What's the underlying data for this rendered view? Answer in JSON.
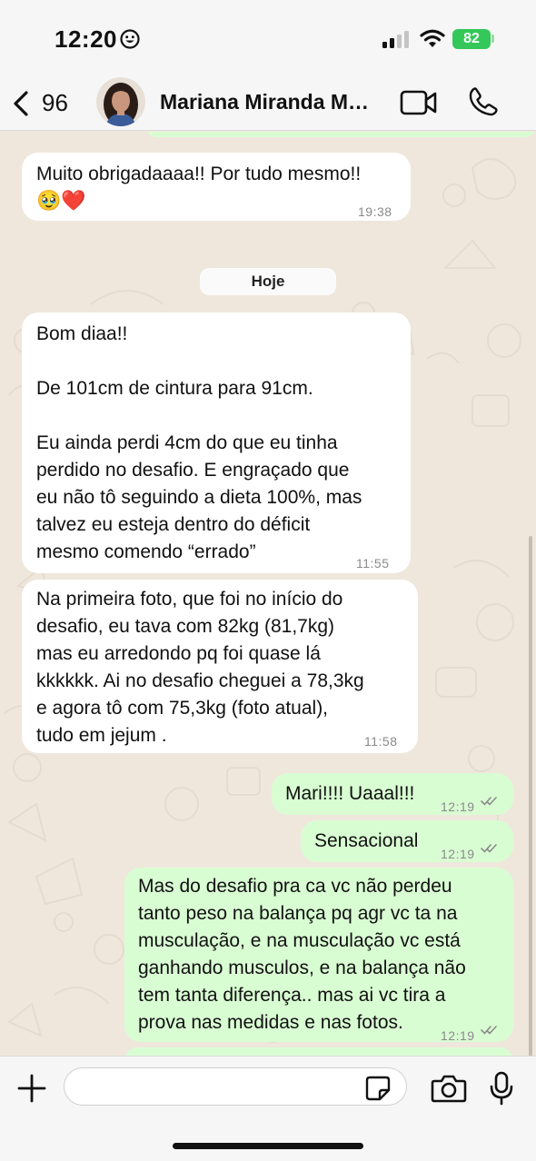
{
  "status_bar": {
    "time": "12:20",
    "battery": "82"
  },
  "header": {
    "back_count": "96",
    "contact_name": "Mariana Miranda Moura"
  },
  "chat": {
    "date_separator": "Hoje",
    "messages": [
      {
        "direction": "in",
        "text": "Muito obrigadaaaa!! Por tudo mesmo!!",
        "emoji": "🥹❤️",
        "time": "19:38"
      },
      {
        "direction": "in",
        "text": "Bom diaa!!\n\nDe 101cm de cintura para 91cm.\n\nEu ainda perdi 4cm do que eu tinha\nperdido no desafio. E engraçado que\neu não tô seguindo a dieta 100%, mas\ntalvez eu esteja dentro do déficit\nmesmo comendo “errado”",
        "time": "11:55"
      },
      {
        "direction": "in",
        "text": "Na primeira foto, que foi no início do\ndesafio, eu tava com 82kg (81,7kg)\nmas eu arredondo pq foi quase lá\nkkkkkk. Ai no desafio cheguei a 78,3kg\ne agora tô com 75,3kg (foto atual),\ntudo em jejum .",
        "time": "11:58"
      },
      {
        "direction": "out",
        "text": "Mari!!!! Uaaal!!!",
        "time": "12:19"
      },
      {
        "direction": "out",
        "text": "Sensacional",
        "time": "12:19"
      },
      {
        "direction": "out",
        "text": "Mas do desafio pra ca vc não perdeu\ntanto peso na balança pq agr vc ta na\nmusculação, e na musculação vc está\nganhando musculos, e na balança não\ntem tanta diferença.. mas ai vc tira a\nprova nas medidas e nas fotos.",
        "time": "12:19"
      }
    ]
  },
  "input": {
    "placeholder": "",
    "value": ""
  },
  "colors": {
    "outgoing_bubble": "#d9fdd3",
    "incoming_bubble": "#ffffff",
    "wallpaper": "#efe7dc",
    "battery": "#34c759",
    "read_ticks": "#8a8a8a"
  },
  "icons": {
    "back": "chevron-left-icon",
    "video": "video-camera-icon",
    "phone": "phone-icon",
    "add": "plus-icon",
    "sticker": "sticker-icon",
    "camera": "camera-icon",
    "mic": "microphone-icon"
  }
}
